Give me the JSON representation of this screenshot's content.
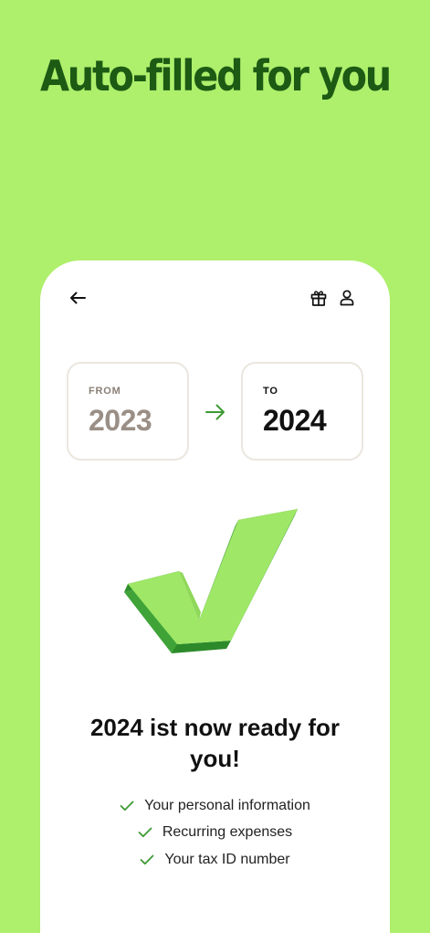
{
  "headline": "Auto-filled for you",
  "header": {
    "back_icon": "arrow-left-icon",
    "gift_icon": "gift-icon",
    "profile_icon": "person-icon"
  },
  "from_box": {
    "label": "FROM",
    "year": "2023"
  },
  "to_box": {
    "label": "TO",
    "year": "2024"
  },
  "transition_icon": "arrow-right-icon",
  "illustration_icon": "checkmark-3d-icon",
  "ready_title": "2024 ist now ready for you!",
  "checklist": [
    {
      "text": "Your personal information",
      "icon": "check-icon"
    },
    {
      "text": "Recurring expenses",
      "icon": "check-icon"
    },
    {
      "text": "Your tax ID number",
      "icon": "check-icon"
    }
  ],
  "colors": {
    "background": "#aeef6c",
    "headline": "#1d5a14",
    "accent_green": "#3e9a35",
    "card": "#ffffff"
  }
}
